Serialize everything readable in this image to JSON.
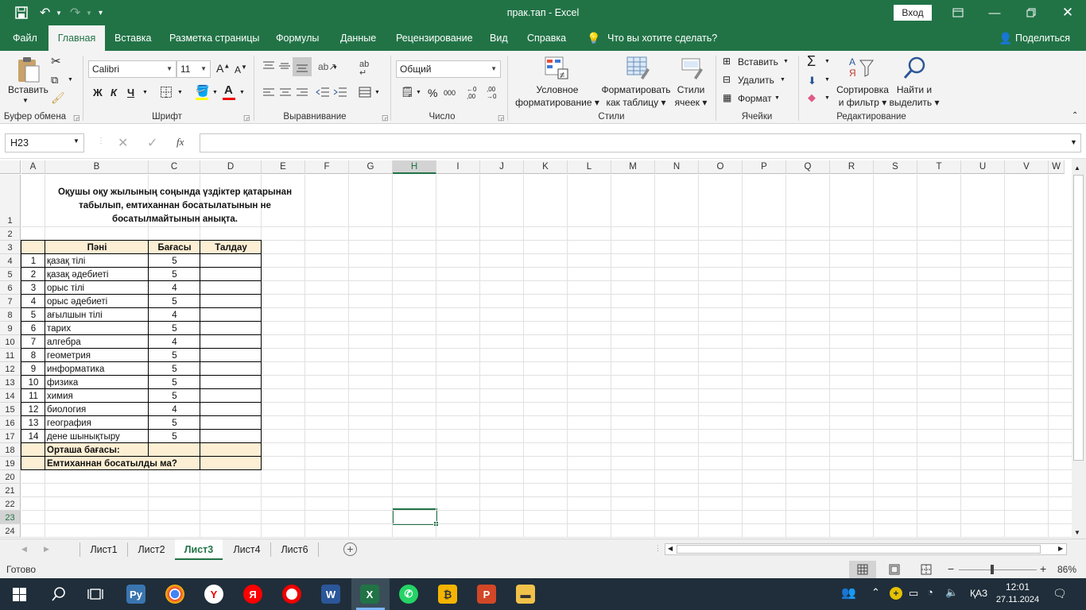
{
  "window": {
    "title": "прак.тап  -  Excel",
    "signin": "Вход"
  },
  "tabs": [
    "Файл",
    "Главная",
    "Вставка",
    "Разметка страницы",
    "Формулы",
    "Данные",
    "Рецензирование",
    "Вид",
    "Справка",
    "Что вы хотите сделать?"
  ],
  "share": "Поделиться",
  "ribbon": {
    "clipboard": {
      "paste": "Вставить",
      "group": "Буфер обмена"
    },
    "font": {
      "name": "Calibri",
      "size": "11",
      "bold": "Ж",
      "italic": "К",
      "underline": "Ч",
      "group": "Шрифт"
    },
    "alignment": {
      "group": "Выравнивание"
    },
    "number": {
      "format": "Общий",
      "group": "Число"
    },
    "styles": {
      "conditional": [
        "Условное",
        "форматирование"
      ],
      "table": [
        "Форматировать",
        "как таблицу"
      ],
      "cell": [
        "Стили",
        "ячеек"
      ],
      "group": "Стили"
    },
    "cells": {
      "insert": "Вставить",
      "delete": "Удалить",
      "format": "Формат",
      "group": "Ячейки"
    },
    "editing": {
      "sort": [
        "Сортировка",
        "и фильтр"
      ],
      "find": [
        "Найти и",
        "выделить"
      ],
      "group": "Редактирование"
    }
  },
  "namebox": "H23",
  "fx": "fx",
  "columns": [
    "A",
    "B",
    "C",
    "D",
    "E",
    "F",
    "G",
    "H",
    "I",
    "J",
    "K",
    "L",
    "M",
    "N",
    "O",
    "P",
    "Q",
    "R",
    "S",
    "T",
    "U",
    "V",
    "W"
  ],
  "rows": [
    "1",
    "2",
    "3",
    "4",
    "5",
    "6",
    "7",
    "8",
    "9",
    "10",
    "11",
    "12",
    "13",
    "14",
    "15",
    "16",
    "17",
    "18",
    "19",
    "20",
    "21",
    "22",
    "23",
    "24"
  ],
  "sheet": {
    "title_lines": [
      "Оқушы оқу жылының соңында үздіктер қатарынан",
      "табылып, емтиханнан босатылатынын не",
      "босатылмайтынын анықта."
    ],
    "headers": [
      "Пәні",
      "Бағасы",
      "Талдау"
    ],
    "subjects": [
      {
        "n": "1",
        "name": "қазақ тілі",
        "grade": "5"
      },
      {
        "n": "2",
        "name": "қазақ әдебиеті",
        "grade": "5"
      },
      {
        "n": "3",
        "name": "орыс тілі",
        "grade": "4"
      },
      {
        "n": "4",
        "name": "орыс әдебиеті",
        "grade": "5"
      },
      {
        "n": "5",
        "name": "ағылшын тілі",
        "grade": "4"
      },
      {
        "n": "6",
        "name": "тарих",
        "grade": "5"
      },
      {
        "n": "7",
        "name": "алгебра",
        "grade": "4"
      },
      {
        "n": "8",
        "name": "геометрия",
        "grade": "5"
      },
      {
        "n": "9",
        "name": "информатика",
        "grade": "5"
      },
      {
        "n": "10",
        "name": "физика",
        "grade": "5"
      },
      {
        "n": "11",
        "name": "химия",
        "grade": "5"
      },
      {
        "n": "12",
        "name": "биология",
        "grade": "4"
      },
      {
        "n": "13",
        "name": "география",
        "grade": "5"
      },
      {
        "n": "14",
        "name": "дене шынықтыру",
        "grade": "5"
      }
    ],
    "avg_label": "Орташа бағасы:",
    "exempt_label": "Емтиханнан босатылды ма?"
  },
  "sheets": [
    "Лист1",
    "Лист2",
    "Лист3",
    "Лист4",
    "Лист6"
  ],
  "active_sheet": "Лист3",
  "status": {
    "ready": "Готово",
    "zoom": "86%"
  },
  "tray": {
    "lang": "ҚАЗ",
    "time": "12:01",
    "date": "27.11.2024"
  },
  "colors": {
    "accent": "#217346",
    "fill": "#fdefd4",
    "taskbar": "#1f2e3a"
  }
}
